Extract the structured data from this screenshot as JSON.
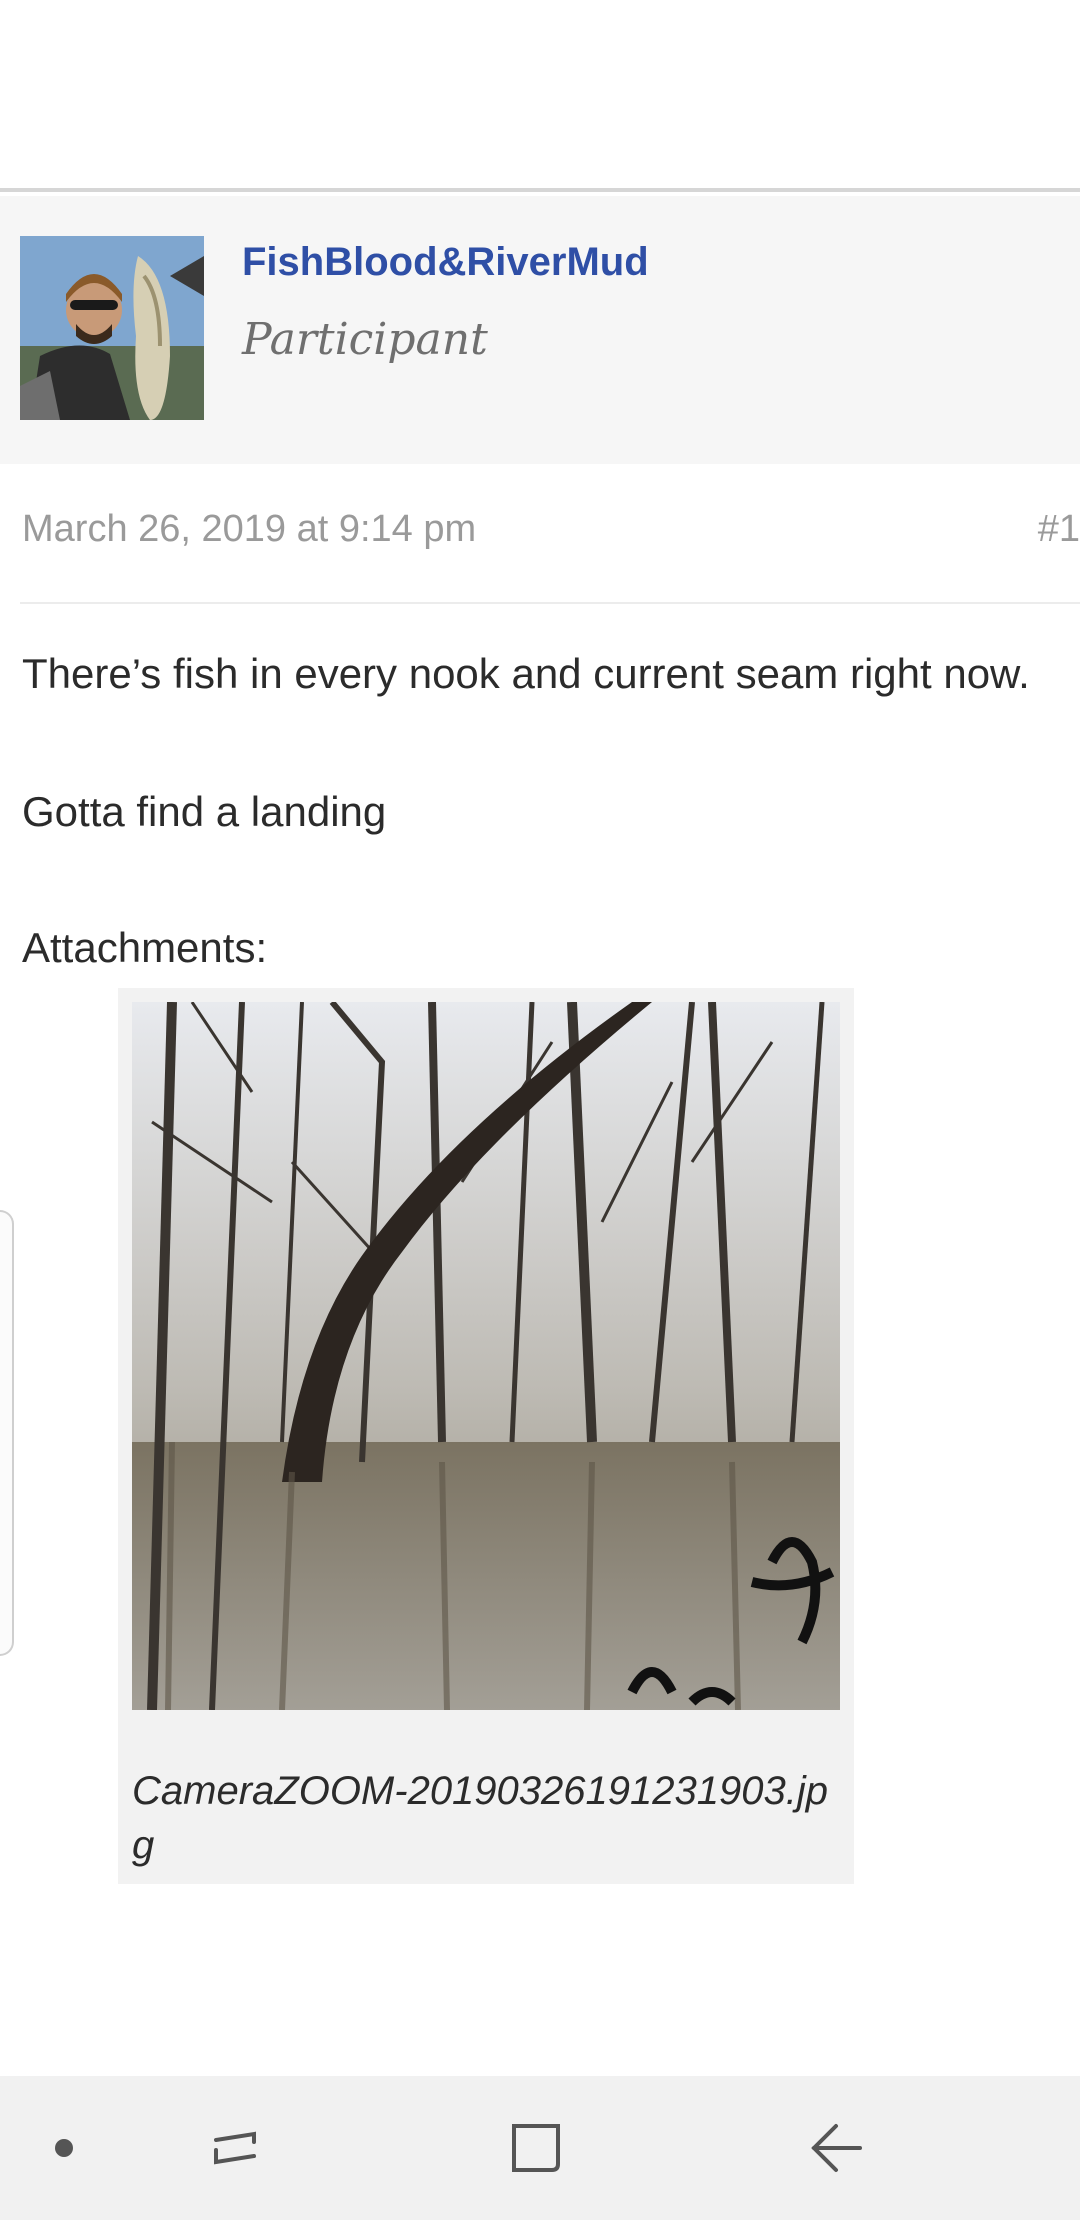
{
  "author": {
    "name": "FishBlood&RiverMud",
    "role": "Participant",
    "avatar_icon": "user-avatar-photo"
  },
  "post": {
    "date": "March 26, 2019 at 9:14 pm",
    "id": "#1",
    "lines": [
      "There’s fish in every nook and current seam right now.",
      "Gotta find a landing",
      "Attachments:"
    ]
  },
  "attachment": {
    "filename": "CameraZOOM-20190326191231903.jpg",
    "photo_icon": "flooded-forest-photo"
  },
  "navbar": {
    "icons": [
      "dot-icon",
      "recent-apps-icon",
      "home-icon",
      "back-icon"
    ]
  },
  "colors": {
    "author_link": "#2f4fa6",
    "muted_text": "#9a9a9a",
    "card_bg": "#f6f6f6"
  }
}
